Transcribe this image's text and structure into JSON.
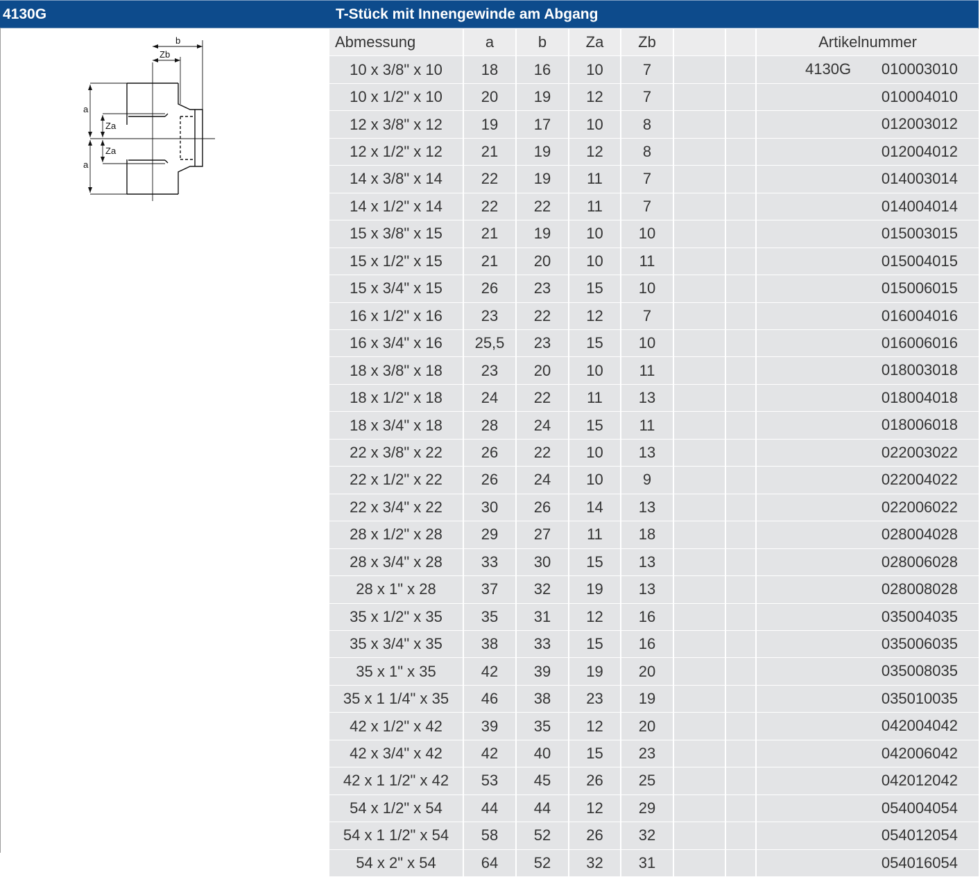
{
  "header": {
    "product_code": "4130G",
    "title": "T-Stück mit Innengewinde am Abgang"
  },
  "diagram": {
    "labels": {
      "b": "b",
      "zb": "Zb",
      "a_top": "a",
      "za_top": "Za",
      "za_bottom": "Za",
      "a_bottom": "a"
    }
  },
  "table": {
    "headers": [
      "Abmessung",
      "a",
      "b",
      "Za",
      "Zb",
      "",
      "",
      "Artikelnummer"
    ],
    "article_prefix": "4130G",
    "rows": [
      [
        "10 x 3/8\" x 10",
        "18",
        "16",
        "10",
        "7",
        "010003010"
      ],
      [
        "10 x 1/2\" x 10",
        "20",
        "19",
        "12",
        "7",
        "010004010"
      ],
      [
        "12 x 3/8\" x 12",
        "19",
        "17",
        "10",
        "8",
        "012003012"
      ],
      [
        "12 x 1/2\" x 12",
        "21",
        "19",
        "12",
        "8",
        "012004012"
      ],
      [
        "14 x 3/8\" x 14",
        "22",
        "19",
        "11",
        "7",
        "014003014"
      ],
      [
        "14 x 1/2\" x 14",
        "22",
        "22",
        "11",
        "7",
        "014004014"
      ],
      [
        "15 x 3/8\" x 15",
        "21",
        "19",
        "10",
        "10",
        "015003015"
      ],
      [
        "15 x 1/2\" x 15",
        "21",
        "20",
        "10",
        "11",
        "015004015"
      ],
      [
        "15 x 3/4\" x 15",
        "26",
        "23",
        "15",
        "10",
        "015006015"
      ],
      [
        "16 x 1/2\" x 16",
        "23",
        "22",
        "12",
        "7",
        "016004016"
      ],
      [
        "16 x 3/4\" x 16",
        "25,5",
        "23",
        "15",
        "10",
        "016006016"
      ],
      [
        "18 x 3/8\" x 18",
        "23",
        "20",
        "10",
        "11",
        "018003018"
      ],
      [
        "18 x 1/2\" x 18",
        "24",
        "22",
        "11",
        "13",
        "018004018"
      ],
      [
        "18 x 3/4\" x 18",
        "28",
        "24",
        "15",
        "11",
        "018006018"
      ],
      [
        "22 x 3/8\" x 22",
        "26",
        "22",
        "10",
        "13",
        "022003022"
      ],
      [
        "22 x 1/2\" x 22",
        "26",
        "24",
        "10",
        "9",
        "022004022"
      ],
      [
        "22 x 3/4\" x 22",
        "30",
        "26",
        "14",
        "13",
        "022006022"
      ],
      [
        "28 x 1/2\" x 28",
        "29",
        "27",
        "11",
        "18",
        "028004028"
      ],
      [
        "28 x 3/4\" x 28",
        "33",
        "30",
        "15",
        "13",
        "028006028"
      ],
      [
        "28 x 1\" x 28",
        "37",
        "32",
        "19",
        "13",
        "028008028"
      ],
      [
        "35 x 1/2\" x 35",
        "35",
        "31",
        "12",
        "16",
        "035004035"
      ],
      [
        "35 x 3/4\" x 35",
        "38",
        "33",
        "15",
        "16",
        "035006035"
      ],
      [
        "35 x 1\" x 35",
        "42",
        "39",
        "19",
        "20",
        "035008035"
      ],
      [
        "35 x 1 1/4\" x 35",
        "46",
        "38",
        "23",
        "19",
        "035010035"
      ],
      [
        "42 x 1/2\" x 42",
        "39",
        "35",
        "12",
        "20",
        "042004042"
      ],
      [
        "42 x 3/4\" x 42",
        "42",
        "40",
        "15",
        "23",
        "042006042"
      ],
      [
        "42 x 1 1/2\" x 42",
        "53",
        "45",
        "26",
        "25",
        "042012042"
      ],
      [
        "54 x 1/2\" x 54",
        "44",
        "44",
        "12",
        "29",
        "054004054"
      ],
      [
        "54 x 1 1/2\" x 54",
        "58",
        "52",
        "26",
        "32",
        "054012054"
      ],
      [
        "54 x 2\" x 54",
        "64",
        "52",
        "32",
        "31",
        "054016054"
      ]
    ]
  }
}
